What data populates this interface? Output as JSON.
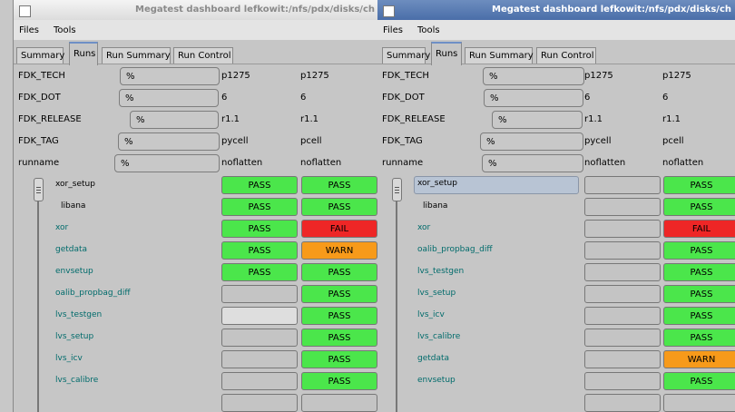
{
  "colors": {
    "pass": "#4be64b",
    "fail": "#ee2626",
    "warn": "#f79a1a",
    "empty": "#c4c4c4"
  },
  "windows": [
    {
      "title": "Megatest dashboard lefkowit:/nfs/pdx/disks/ch",
      "menus": [
        "Files",
        "Tools"
      ],
      "tabs": [
        "Summary",
        "Runs",
        "Run Summary",
        "Run Control"
      ],
      "active_tab": "Runs",
      "fields": [
        {
          "label": "FDK_TECH",
          "value": "%",
          "col1": "p1275",
          "col2": "p1275"
        },
        {
          "label": "FDK_DOT",
          "value": "%",
          "col1": "6",
          "col2": "6"
        },
        {
          "label": "FDK_RELEASE",
          "value": "%",
          "col1": "r1.1",
          "col2": "r1.1"
        },
        {
          "label": "FDK_TAG",
          "value": "%",
          "col1": "pycell",
          "col2": "pcell"
        },
        {
          "label": "runname",
          "value": "%",
          "col1": "noflatten",
          "col2": "noflatten"
        }
      ],
      "tests": [
        {
          "name": "xor_setup",
          "col1": "PASS",
          "col2": "PASS"
        },
        {
          "name": "libana",
          "col1": "PASS",
          "col2": "PASS"
        },
        {
          "name": "xor",
          "col1": "PASS",
          "col2": "FAIL"
        },
        {
          "name": "getdata",
          "col1": "PASS",
          "col2": "WARN"
        },
        {
          "name": "envsetup",
          "col1": "PASS",
          "col2": "PASS"
        },
        {
          "name": "oalib_propbag_diff",
          "col1": "",
          "col2": "PASS"
        },
        {
          "name": "lvs_testgen",
          "col1": "",
          "col2": "PASS"
        },
        {
          "name": "lvs_setup",
          "col1": "",
          "col2": "PASS"
        },
        {
          "name": "lvs_icv",
          "col1": "",
          "col2": "PASS"
        },
        {
          "name": "lvs_calibre",
          "col1": "",
          "col2": "PASS"
        },
        {
          "name": "",
          "col1": "",
          "col2": ""
        }
      ]
    },
    {
      "title": "Megatest dashboard lefkowit:/nfs/pdx/disks/ch",
      "menus": [
        "Files",
        "Tools"
      ],
      "tabs": [
        "Summary",
        "Runs",
        "Run Summary",
        "Run Control"
      ],
      "active_tab": "Runs",
      "fields": [
        {
          "label": "FDK_TECH",
          "value": "%",
          "col1": "p1275",
          "col2": "p1275"
        },
        {
          "label": "FDK_DOT",
          "value": "%",
          "col1": "6",
          "col2": "6"
        },
        {
          "label": "FDK_RELEASE",
          "value": "%",
          "col1": "r1.1",
          "col2": "r1.1"
        },
        {
          "label": "FDK_TAG",
          "value": "%",
          "col1": "pycell",
          "col2": "pcell"
        },
        {
          "label": "runname",
          "value": "%",
          "col1": "noflatten",
          "col2": "noflatten"
        }
      ],
      "tests": [
        {
          "name": "xor_setup",
          "col1": "",
          "col2": "PASS"
        },
        {
          "name": "libana",
          "col1": "",
          "col2": "PASS"
        },
        {
          "name": "xor",
          "col1": "",
          "col2": "FAIL"
        },
        {
          "name": "oalib_propbag_diff",
          "col1": "",
          "col2": "PASS"
        },
        {
          "name": "lvs_testgen",
          "col1": "",
          "col2": "PASS"
        },
        {
          "name": "lvs_setup",
          "col1": "",
          "col2": "PASS"
        },
        {
          "name": "lvs_icv",
          "col1": "",
          "col2": "PASS"
        },
        {
          "name": "lvs_calibre",
          "col1": "",
          "col2": "PASS"
        },
        {
          "name": "getdata",
          "col1": "",
          "col2": "WARN"
        },
        {
          "name": "envsetup",
          "col1": "",
          "col2": "PASS"
        },
        {
          "name": "",
          "col1": "",
          "col2": ""
        }
      ]
    }
  ]
}
